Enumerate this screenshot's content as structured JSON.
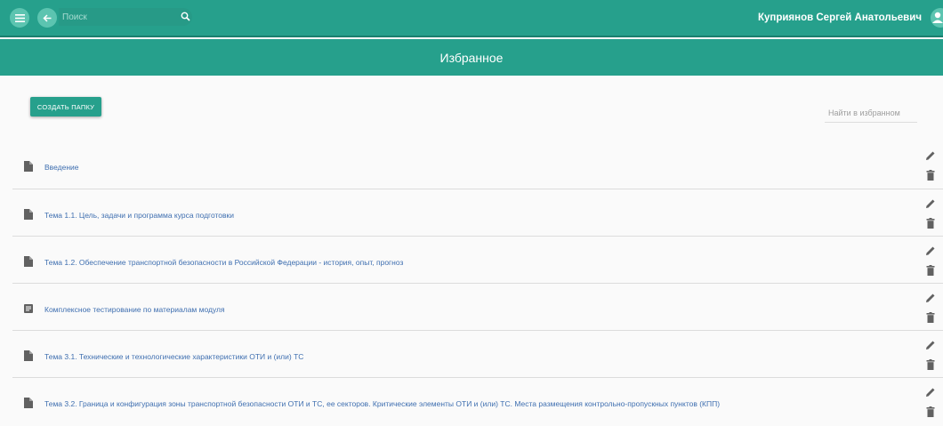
{
  "header": {
    "search_placeholder": "Поиск",
    "user_name": "Куприянов Сергей Анатольевич"
  },
  "page": {
    "title": "Избранное",
    "create_folder_label": "Создать папку",
    "favorites_search_placeholder": "Найти в избранном"
  },
  "items": [
    {
      "label": "Введение",
      "icon": "file-icon"
    },
    {
      "label": "Тема 1.1. Цель, задачи и программа курса подготовки",
      "icon": "file-icon"
    },
    {
      "label": "Тема 1.2. Обеспечение транспортной безопасности в Российской Федерации - история, опыт, прогноз",
      "icon": "file-icon"
    },
    {
      "label": "Комплексное тестирование по материалам модуля",
      "icon": "test-icon"
    },
    {
      "label": "Тема 3.1. Технические и технологические характеристики ОТИ и (или) ТС",
      "icon": "file-icon"
    },
    {
      "label": "Тема 3.2. Граница и конфигурация зоны транспортной безопасности ОТИ и ТС, ее секторов. Критические элементы ОТИ и (или) ТС. Места размещения контрольно-пропускных пунктов (КПП)",
      "icon": "file-icon"
    }
  ],
  "colors": {
    "primary": "#26a08c",
    "link": "#3f6fb0"
  }
}
